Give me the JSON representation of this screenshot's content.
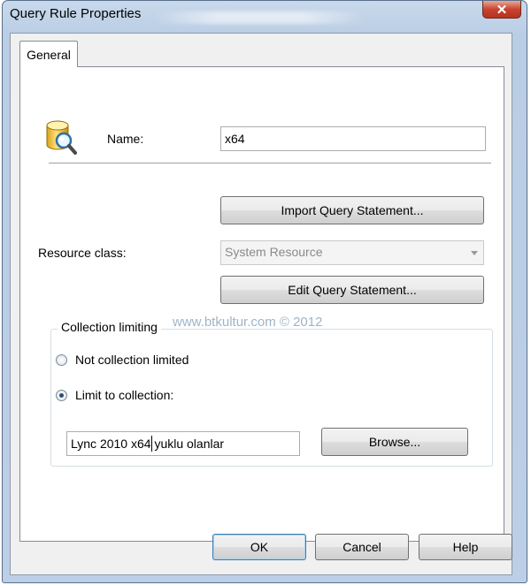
{
  "window": {
    "title": "Query Rule Properties",
    "close_glyph": "✕"
  },
  "tabs": [
    {
      "label": "General",
      "active": true
    }
  ],
  "general": {
    "name_label": "Name:",
    "name_value": "x64",
    "import_button": "Import Query Statement...",
    "resource_class_label": "Resource class:",
    "resource_class_value": "System Resource",
    "edit_button": "Edit Query Statement...",
    "collection_group_title": "Collection limiting",
    "radio_not_limited": "Not collection limited",
    "radio_limit_to": "Limit to collection:",
    "selected_radio": "limit_to_collection",
    "collection_value": "Lync 2010 x64 yuklu olanlar",
    "browse_button": "Browse..."
  },
  "watermark": "www.btkultur.com © 2012",
  "footer": {
    "ok": "OK",
    "cancel": "Cancel",
    "help": "Help"
  },
  "icons": {
    "query_rule": "database-search-icon"
  },
  "colors": {
    "titlebar": "#bccfe6",
    "close_button": "#c7442e",
    "button_focus": "#3c7fb1"
  }
}
